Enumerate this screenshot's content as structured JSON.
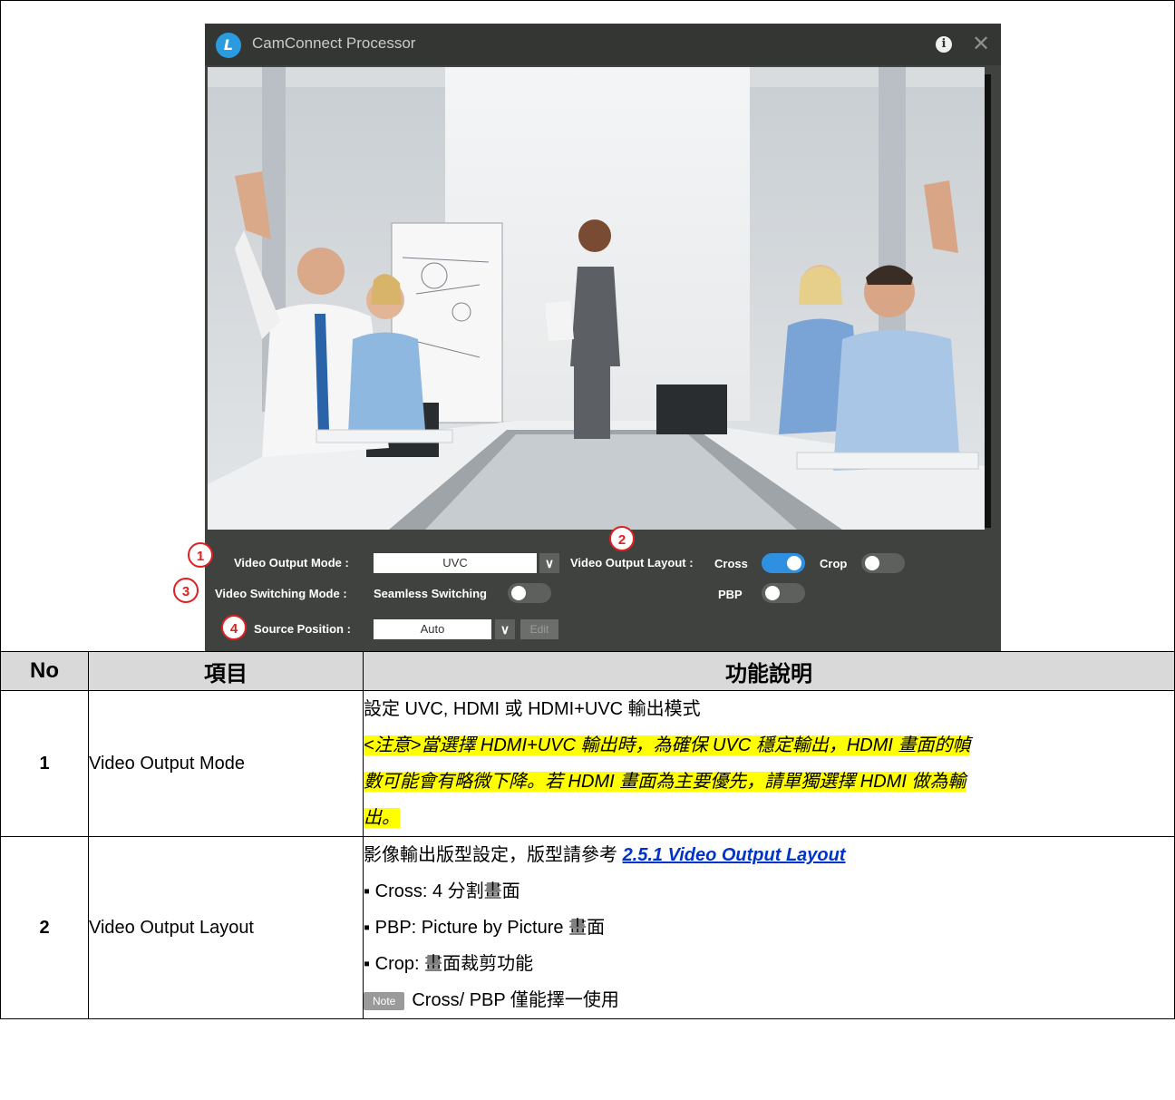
{
  "app": {
    "title": "CamConnect Processor",
    "logo_letter": "L",
    "icons": {
      "info": "info-icon",
      "close": "close-icon"
    }
  },
  "controls": {
    "video_output_mode_label": "Video Output Mode :",
    "video_output_mode_value": "UVC",
    "video_output_layout_label": "Video Output Layout :",
    "cross_label": "Cross",
    "cross_on": true,
    "crop_label": "Crop",
    "crop_on": false,
    "pbp_label": "PBP",
    "pbp_on": false,
    "video_switching_mode_label": "Video Switching Mode :",
    "seamless_switching_label": "Seamless Switching",
    "seamless_on": false,
    "source_position_label": "Source Position :",
    "source_position_value": "Auto",
    "edit_label": "Edit",
    "dropdown_glyph": "∨"
  },
  "badges": [
    "1",
    "2",
    "3",
    "4"
  ],
  "table": {
    "headers": {
      "no": "No",
      "item": "項目",
      "desc": "功能說明"
    },
    "rows": [
      {
        "no": "1",
        "item": "Video Output Mode",
        "desc_line1": "設定 UVC, HDMI  或 HDMI+UVC  輸出模式",
        "note_line1": "<注意>當選擇 HDMI+UVC 輸出時，為確保 UVC 穩定輸出，HDMI 畫面的幀",
        "note_line2": "數可能會有略微下降。若 HDMI 畫面為主要優先，請單獨選擇 HDMI 做為輸",
        "note_line3": "出。"
      },
      {
        "no": "2",
        "item": "Video Output Layout",
        "desc_intro": "影像輸出版型設定，版型請參考 ",
        "desc_link": "2.5.1 Video Output Layout",
        "bullet1": "▪ Cross: 4 分割畫面",
        "bullet2": "▪ PBP: Picture by Picture 畫面",
        "bullet3": "▪ Crop:  畫面裁剪功能",
        "note_tag": "Note",
        "note_text": "Cross/ PBP  僅能擇一使用"
      }
    ]
  }
}
